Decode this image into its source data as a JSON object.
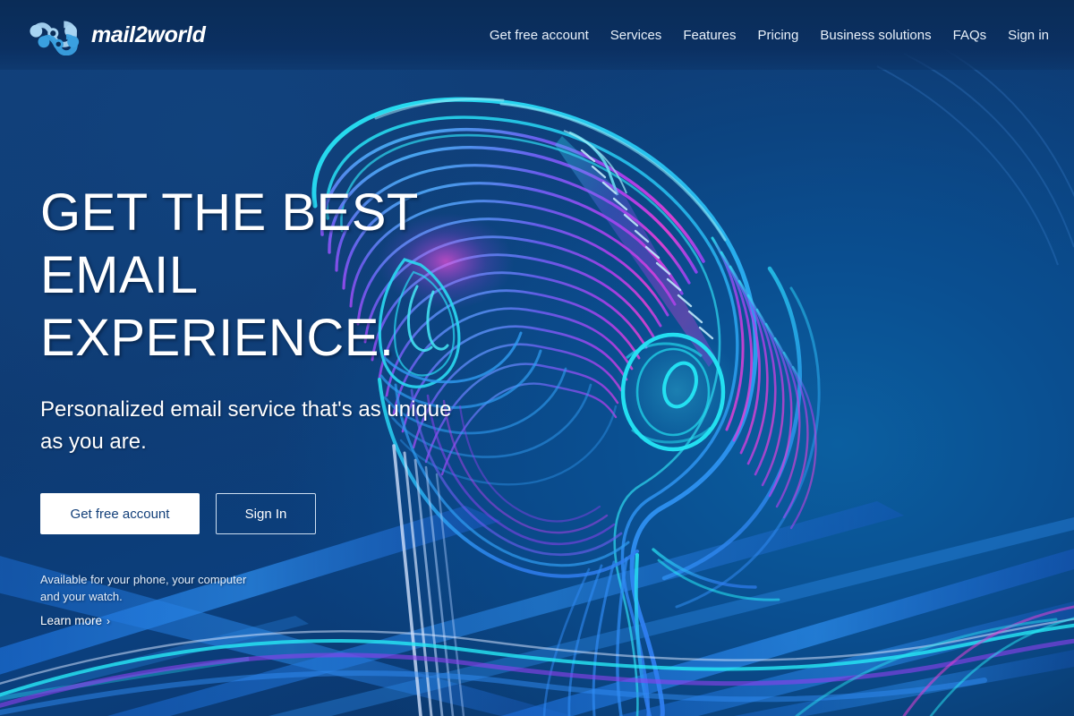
{
  "header": {
    "brand_name": "mail2world",
    "logo_icon": "molecule-network-icon",
    "nav": [
      {
        "label": "Get free account",
        "name": "nav-get-free-account"
      },
      {
        "label": "Services",
        "name": "nav-services"
      },
      {
        "label": "Features",
        "name": "nav-features"
      },
      {
        "label": "Pricing",
        "name": "nav-pricing"
      },
      {
        "label": "Business solutions",
        "name": "nav-business-solutions"
      },
      {
        "label": "FAQs",
        "name": "nav-faqs"
      },
      {
        "label": "Sign in",
        "name": "nav-sign-in"
      }
    ]
  },
  "hero": {
    "headline": "GET THE BEST EMAIL EXPERIENCE.",
    "subheadline": "Personalized email service that's as unique as you are.",
    "primary_cta": "Get free account",
    "secondary_cta": "Sign In",
    "availability_note": "Available for your phone, your computer and your watch.",
    "learn_more": "Learn more",
    "learn_more_chevron": "›"
  },
  "artwork": {
    "description": "neon line-art profile of a head wearing headphones, contour lines",
    "alt": "Neon contour illustration of a person's head in profile"
  },
  "colors": {
    "header_bg": "#0a2c57",
    "page_bg_dark": "#0a2f5d",
    "page_bg_mid": "#123f79",
    "page_bg_light": "#0b5fa0",
    "text_primary": "#ffffff",
    "btn_primary_bg": "#ffffff",
    "btn_primary_text": "#123f79",
    "btn_secondary_border": "#cddef1",
    "neon_cyan": "#22e6f0",
    "neon_blue": "#2b8cf5",
    "neon_purple": "#8d3ff0",
    "neon_magenta": "#e238d8",
    "logo_light": "#a8d4f2",
    "logo_mid": "#3aa0e0"
  }
}
